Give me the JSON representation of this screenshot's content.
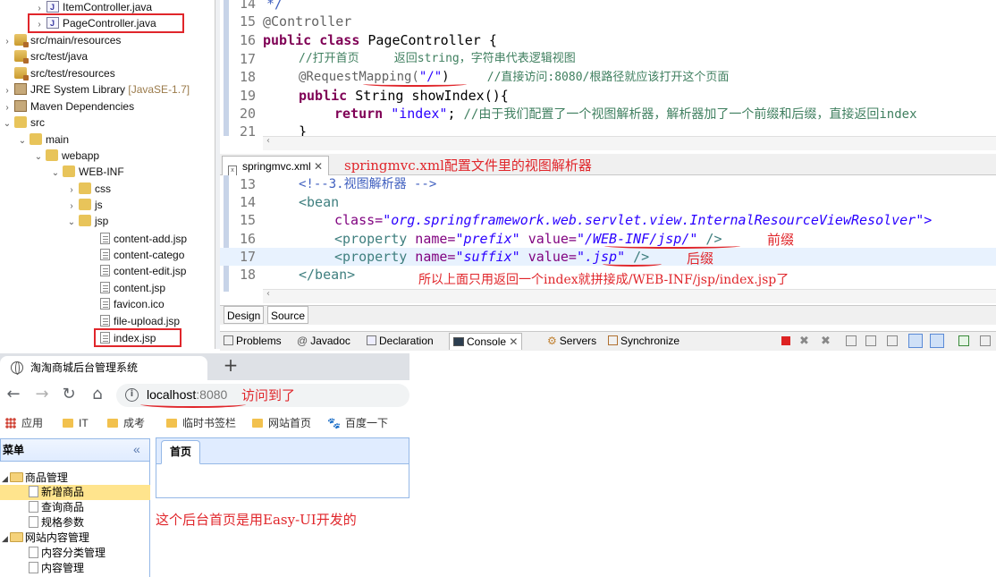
{
  "eclipse": {
    "tree": {
      "items": [
        {
          "label": "ItemController.java"
        },
        {
          "label": "PageController.java"
        },
        {
          "label": "src/main/resources"
        },
        {
          "label": "src/test/java"
        },
        {
          "label": "src/test/resources"
        },
        {
          "label": "JRE System Library",
          "note": "[JavaSE-1.7]"
        },
        {
          "label": "Maven Dependencies"
        },
        {
          "label": "src"
        },
        {
          "label": "main"
        },
        {
          "label": "webapp"
        },
        {
          "label": "WEB-INF"
        },
        {
          "label": "css"
        },
        {
          "label": "js"
        },
        {
          "label": "jsp"
        },
        {
          "label": "content-add.jsp"
        },
        {
          "label": "content-catego"
        },
        {
          "label": "content-edit.jsp"
        },
        {
          "label": "content.jsp"
        },
        {
          "label": "favicon.ico"
        },
        {
          "label": "file-upload.jsp"
        },
        {
          "label": "index.jsp"
        }
      ]
    },
    "java_editor": {
      "line_numbers": [
        "14",
        "15",
        "16",
        "17",
        "18",
        "19",
        "20",
        "21"
      ],
      "lines": {
        "l14": "*/",
        "l15_ann": "@Controller",
        "l16_kw": "public class",
        "l16_rest": " PageController {",
        "l17_cmt": "//打开首页     返回string，字符串代表逻辑视图",
        "l18_ann": "@RequestMapping(",
        "l18_str": "\"/\"",
        "l18_close": ")",
        "l18_cmt": "//直接访问:8080/根路径就应该打开这个页面",
        "l19_kw": "public",
        "l19_rest": " String showIndex(){",
        "l20_kw": "return",
        "l20_str": " \"index\"",
        "l20_semi": "; ",
        "l20_cmt": "//由于我们配置了一个视图解析器，解析器加了一个前缀和后缀，直接返回index",
        "l21": "}"
      }
    },
    "xml_tab": {
      "label": "springmvc.xml",
      "close": "✕"
    },
    "xml_tab_annotation": "springmvc.xml配置文件里的视图解析器",
    "xml_editor": {
      "line_numbers": [
        "13",
        "14",
        "15",
        "16",
        "17",
        "18"
      ],
      "l13_cmt": "<!--3.视图解析器 -->",
      "l14_tag": "<bean",
      "l15_attr": "class=",
      "l15_val": "\"org.springframework.web.servlet.view.InternalResourceViewResolver\">",
      "l16_tag": "<property",
      "l16_attr1": " name=",
      "l16_val1": "\"prefix\"",
      "l16_attr2": " value=",
      "l16_val2": "\"/WEB-INF/jsp/\"",
      "l16_end": " />",
      "l16_note": "前缀",
      "l17_tag": "<property",
      "l17_attr1": " name=",
      "l17_val1": "\"suffix\"",
      "l17_attr2": " value=",
      "l17_val2": "\".jsp\"",
      "l17_end": " />",
      "l17_note": "后缀",
      "l18_tag": "</bean>",
      "l18_note": "所以上面只用返回一个index就拼接成/WEB-INF/jsp/index.jsp了"
    },
    "editor_mode_tabs": [
      "Design",
      "Source"
    ],
    "bottom_views": [
      "Problems",
      "Javadoc",
      "Declaration",
      "Console",
      "Servers",
      "Synchronize"
    ]
  },
  "browser": {
    "tab_title": "淘淘商城后台管理系统",
    "new_tab": "+",
    "url_host": "localhost",
    "url_port": ":8080",
    "url_annotation": "访问到了",
    "bookmarks": [
      "应用",
      "IT",
      "成考",
      "临时书签栏",
      "网站首页",
      "百度一下"
    ]
  },
  "admin": {
    "menu_title": "菜单",
    "collapse": "«",
    "tab_home": "首页",
    "groups": [
      {
        "label": "商品管理",
        "children": [
          "新增商品",
          "查询商品",
          "规格参数"
        ]
      },
      {
        "label": "网站内容管理",
        "children": [
          "内容分类管理",
          "内容管理"
        ]
      }
    ],
    "annotation": "这个后台首页是用Easy-UI开发的"
  },
  "colors": {
    "annotation_red": "#e0262b",
    "eclipse_keyword": "#7f0055",
    "xml_value": "#2a00ff",
    "easyui_border": "#95b8e7"
  }
}
